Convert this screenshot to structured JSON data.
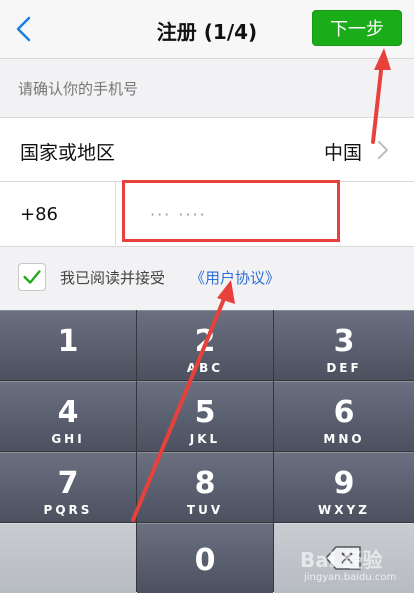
{
  "nav": {
    "title": "注册 (1/4)",
    "next_label": "下一步",
    "back_icon": "chevron-left-icon"
  },
  "section": {
    "label": "请确认你的手机号"
  },
  "country": {
    "label": "国家或地区",
    "value": "中国",
    "chevron_icon": "chevron-right-icon"
  },
  "phone": {
    "code": "+86",
    "value": "··· ····"
  },
  "agreement": {
    "checked": true,
    "text": "我已阅读并接受",
    "link": "《用户协议》"
  },
  "keypad": {
    "keys": [
      {
        "digit": "1",
        "letters": ""
      },
      {
        "digit": "2",
        "letters": "ABC"
      },
      {
        "digit": "3",
        "letters": "DEF"
      },
      {
        "digit": "4",
        "letters": "GHI"
      },
      {
        "digit": "5",
        "letters": "JKL"
      },
      {
        "digit": "6",
        "letters": "MNO"
      },
      {
        "digit": "7",
        "letters": "PQRS"
      },
      {
        "digit": "8",
        "letters": "TUV"
      },
      {
        "digit": "9",
        "letters": "WXYZ"
      },
      {
        "digit": "0",
        "letters": ""
      }
    ]
  },
  "watermark": {
    "main": "Bai 经验",
    "sub": "jingyan.baidu.com"
  },
  "colors": {
    "accent": "#1aad19",
    "link": "#2f6fd6",
    "annotation": "#e8413c"
  }
}
